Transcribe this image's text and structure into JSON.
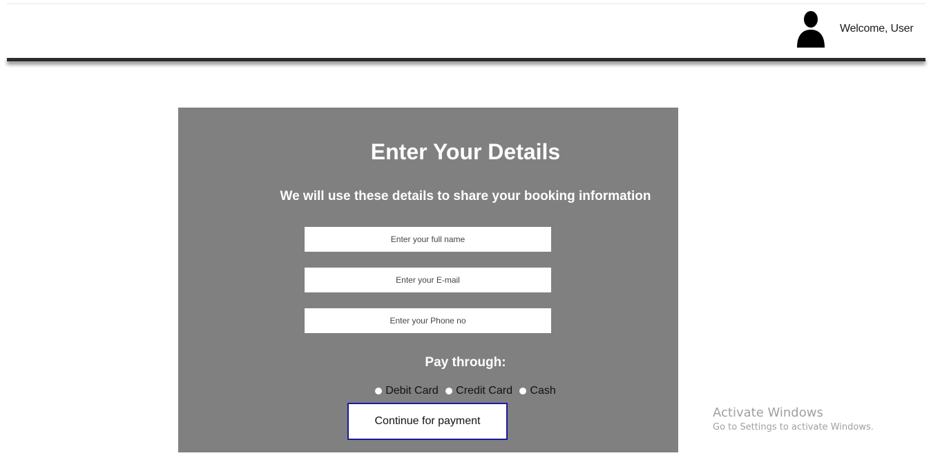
{
  "header": {
    "welcome_text": "Welcome, User",
    "avatar_icon": "user-silhouette-icon"
  },
  "form": {
    "title": "Enter Your Details",
    "subtitle": "We will use these details to share your booking information",
    "fields": {
      "full_name_placeholder": "Enter your full name",
      "email_placeholder": "Enter your E-mail",
      "phone_placeholder": "Enter your Phone no"
    },
    "pay_label": "Pay through:",
    "payment_options": [
      "Debit Card",
      "Credit Card",
      "Cash"
    ],
    "continue_label": "Continue for payment"
  },
  "watermark": {
    "title": "Activate Windows",
    "subtitle": "Go to Settings to activate Windows."
  },
  "colors": {
    "panel_bg": "#808080",
    "button_border": "#1a1aa0",
    "header_bar": "#2b2b2b"
  }
}
